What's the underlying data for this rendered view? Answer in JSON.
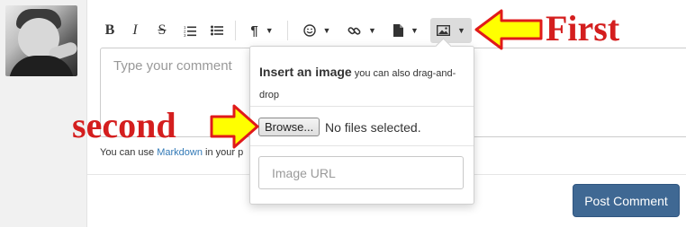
{
  "toolbar": {
    "bold": "B",
    "italic": "I",
    "strike": "S",
    "paragraph": "¶"
  },
  "editor": {
    "placeholder": "Type your comment"
  },
  "help": {
    "prefix": "You can use ",
    "link": "Markdown",
    "suffix": " in your p"
  },
  "popup": {
    "title": "Insert an image",
    "subtitle": " you can also drag-and-drop",
    "browse_label": "Browse...",
    "file_status": "No files selected.",
    "url_placeholder": "Image URL"
  },
  "post_button": "Post Comment",
  "annotations": {
    "first": "First",
    "second": "second",
    "color": "#d41e1e",
    "arrow_color": "#ffff00"
  }
}
